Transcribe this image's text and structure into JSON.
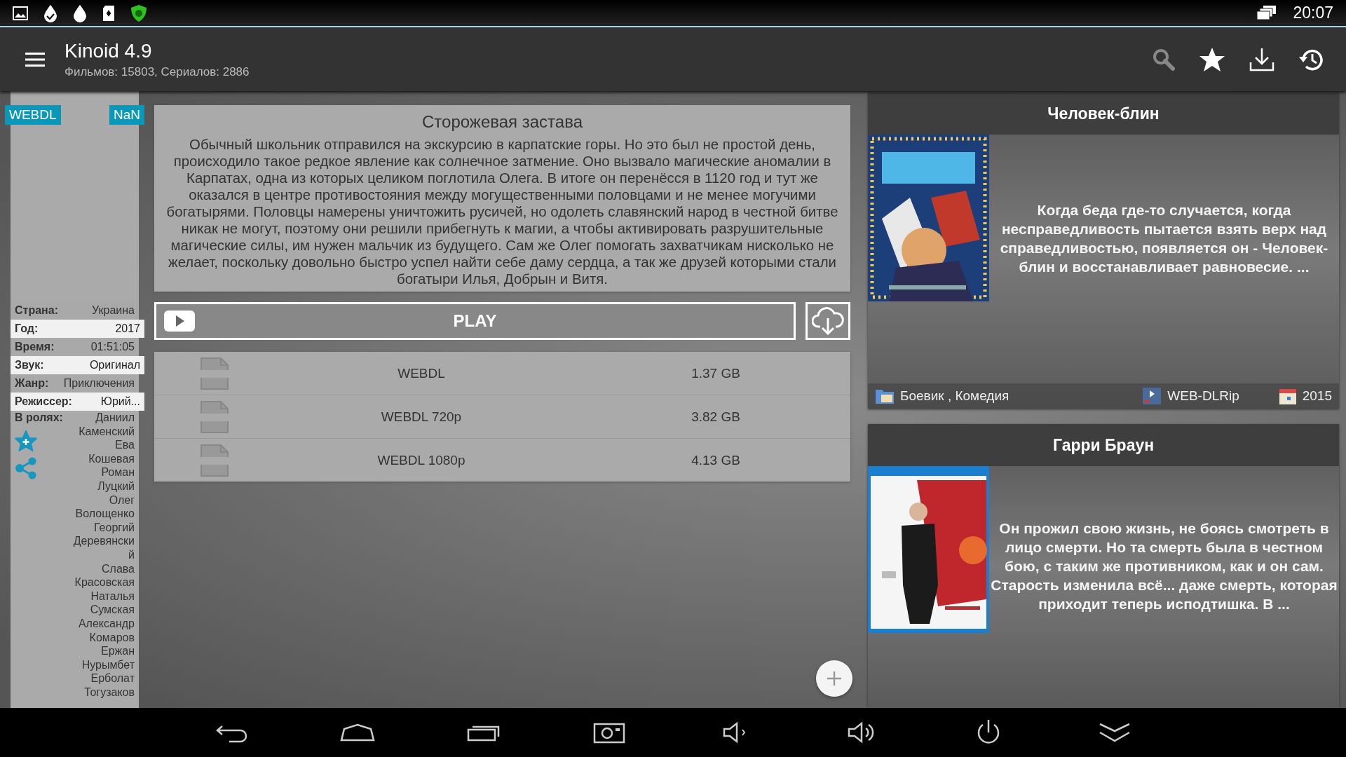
{
  "status_bar": {
    "time": "20:07"
  },
  "app_bar": {
    "title": "Kinoid 4.9",
    "subtitle": "Фильмов: 15803, Сериалов: 2886"
  },
  "details": {
    "badges": [
      "WEBDL",
      "NaN"
    ],
    "info": [
      {
        "label": "Страна:",
        "value": "Украина",
        "highlighted": false
      },
      {
        "label": "Год:",
        "value": "2017",
        "highlighted": true
      },
      {
        "label": "Время:",
        "value": "01:51:05",
        "highlighted": false
      },
      {
        "label": "Звук:",
        "value": "Оригинал",
        "highlighted": true
      },
      {
        "label": "Жанр:",
        "value": "Приключения",
        "highlighted": false
      },
      {
        "label": "Режиссер:",
        "value": "Юрий...",
        "highlighted": true
      }
    ],
    "cast_label": "В ролях:",
    "cast": [
      "Даниил",
      "Каменский",
      "Ева",
      "Кошевая",
      "Роман",
      "Луцкий",
      "Олег",
      "Волощенко",
      "Георгий",
      "Деревянски",
      "й",
      "Слава",
      "Красовская",
      "Наталья",
      "Сумская",
      "Александр",
      "Комаров",
      "Ержан",
      "Нурымбет",
      "Ерболат",
      "Тогузаков"
    ]
  },
  "movie": {
    "title": "Сторожевая застава",
    "description": "Обычный школьник отправился на экскурсию в карпатские горы. Но это был не простой день, происходило такое редкое явление как солнечное затмение. Оно вызвало магические аномалии в Карпатах, одна из которых целиком поглотила Олега. В итоге он перенёсся в 1120 год и тут же оказался в центре противостояния между могущественными половцами и не менее могучими богатырями. Половцы намерены уничтожить русичей, но одолеть славянский народ в честной битве никак не могут, поэтому они решили прибегнуть к магии, а чтобы активировать разрушительные магические силы, им нужен мальчик из будущего. Сам же Олег помогать захватчикам нисколько не желает, поскольку довольно быстро успел найти себе даму сердца, а так же друзей которыми стали богатыри Илья, Добрын и Витя.",
    "play": "PLAY"
  },
  "torrents": [
    {
      "name": "WEBDL",
      "size": "1.37 GB"
    },
    {
      "name": "WEBDL 720p",
      "size": "3.82 GB"
    },
    {
      "name": "WEBDL 1080p",
      "size": "4.13 GB"
    }
  ],
  "recommendations": [
    {
      "title": "Человек-блин",
      "description": "Когда беда где-то случается, когда несправедливость пытается взять верх над справедливостью, появляется он - Человек-блин и восстанавливает равновесие. ...",
      "genres": "Боевик , Комедия",
      "quality": "WEB-DLRip",
      "year": "2015"
    },
    {
      "title": "Гарри Браун",
      "description": "Он прожил свою жизнь, не боясь смотреть в лицо смерти. Но та смерть была в честном бою, с таким же противником, как и он сам. Старость изменила всё... даже смерть, которая приходит теперь исподтишка. В ..."
    }
  ]
}
